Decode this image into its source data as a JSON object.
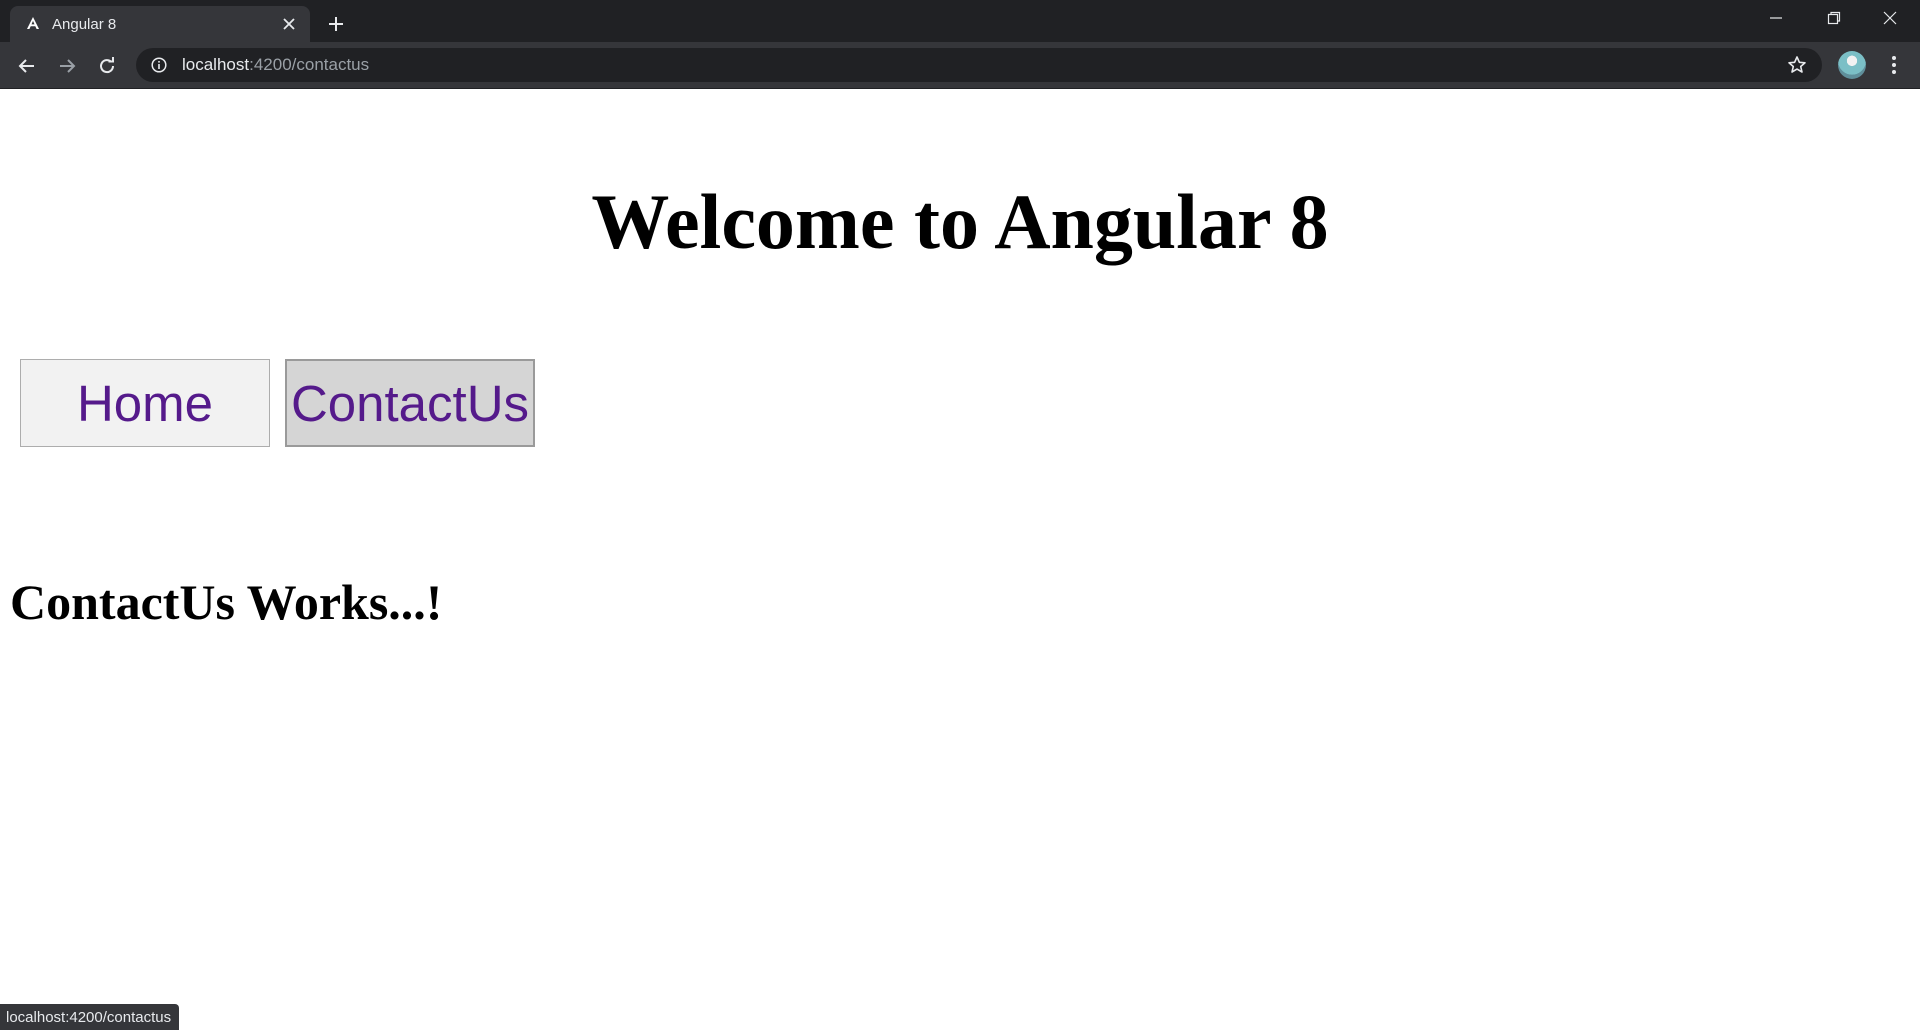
{
  "browser": {
    "tab": {
      "title": "Angular 8",
      "favicon": "angular-icon"
    },
    "address": {
      "host": "localhost",
      "path": ":4200/contactus"
    },
    "status_bar": "localhost:4200/contactus"
  },
  "page": {
    "heading": "Welcome to Angular 8",
    "nav": [
      {
        "label": "Home"
      },
      {
        "label": "ContactUs"
      }
    ],
    "subheading": "ContactUs Works...!"
  },
  "colors": {
    "link": "#551a8b",
    "chrome_dark": "#202124",
    "chrome_tab": "#35363a"
  }
}
